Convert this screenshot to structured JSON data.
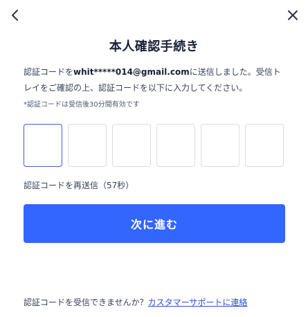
{
  "nav": {
    "back_icon": "chevron-left-icon",
    "close_icon": "close-icon"
  },
  "title": "本人確認手続き",
  "description": {
    "prefix": "認証コードを",
    "email": "whit*****014@gmail.com",
    "suffix": "に送信しました。受信トレイをご確認の上、認証コードを以下に入力してください。"
  },
  "note": "*認証コードは受信後30分間有効です",
  "code_inputs": [
    "",
    "",
    "",
    "",
    "",
    ""
  ],
  "resend": "認証コードを再送信（57秒）",
  "next_button": "次に進む",
  "footer": {
    "question": "認証コードを受信できませんか？",
    "support_link": "カスタマーサポートに連絡"
  },
  "colors": {
    "accent": "#3366ff",
    "link": "#2a4fd6",
    "active_border": "#3d5fd6"
  }
}
